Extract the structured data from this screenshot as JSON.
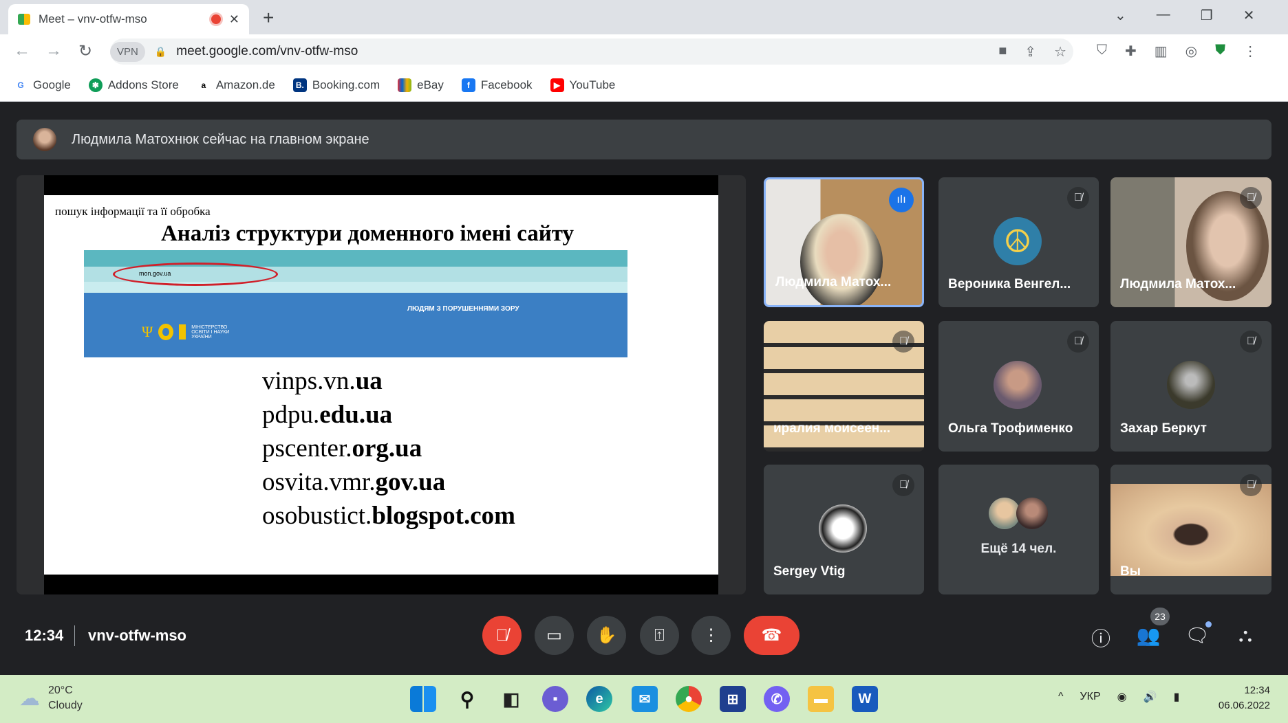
{
  "browser": {
    "tab_title": "Meet – vnv-otfw-mso",
    "url": "meet.google.com/vnv-otfw-mso",
    "vpn_label": "VPN",
    "bookmarks": [
      {
        "label": "Google",
        "color": "#4285f4",
        "glyph": "G"
      },
      {
        "label": "Addons Store",
        "color": "#0f9d58",
        "glyph": "✱"
      },
      {
        "label": "Amazon.de",
        "color": "#ffffff",
        "glyph": "a"
      },
      {
        "label": "Booking.com",
        "color": "#003580",
        "glyph": "B."
      },
      {
        "label": "eBay",
        "color": "#e53238",
        "glyph": "▣"
      },
      {
        "label": "Facebook",
        "color": "#1877f2",
        "glyph": "f"
      },
      {
        "label": "YouTube",
        "color": "#ff0000",
        "glyph": "▶"
      }
    ]
  },
  "banner": {
    "text": "Людмила Матохнюк сейчас на главном экране"
  },
  "slide": {
    "subtitle": "пошук інформації та її обробка",
    "title": "Аналіз структури доменного імені сайту",
    "embedded_site_text": "ЛЮДЯМ З ПОРУШЕННЯМИ ЗОРУ",
    "embedded_logo_text": "МІНІСТЕРСТВО ОСВІТИ І НАУКИ УКРАЇНИ",
    "embedded_url": "mon.gov.ua",
    "domains": [
      {
        "name": "vinps.vn.",
        "suffix": "ua"
      },
      {
        "name": "pdpu.",
        "suffix": "edu.ua"
      },
      {
        "name": "pscenter.",
        "suffix": "org.ua"
      },
      {
        "name": "osvita.vmr.",
        "suffix": "gov.ua"
      },
      {
        "name": "osobustict.",
        "suffix": "blogspot.com"
      }
    ]
  },
  "participants": [
    {
      "name": "Людмила Матох...",
      "speaking": true
    },
    {
      "name": "Вероника Венгел...",
      "muted": true
    },
    {
      "name": "Людмила Матох...",
      "muted": true
    },
    {
      "name": "иралия моисеен...",
      "muted": true
    },
    {
      "name": "Ольга Трофименко",
      "muted": true
    },
    {
      "name": "Захар Беркут",
      "muted": true
    },
    {
      "name": "Sergey Vtig",
      "muted": true
    },
    {
      "name": "Ещё 14 чел."
    },
    {
      "name": "Вы",
      "muted": true
    }
  ],
  "controls": {
    "time": "12:34",
    "meeting_code": "vnv-otfw-mso",
    "participant_count": "23"
  },
  "taskbar": {
    "temp": "20°C",
    "weather": "Cloudy",
    "lang": "УКР",
    "time": "12:34",
    "date": "06.06.2022"
  },
  "colors": {
    "accent": "#1a73e8",
    "danger": "#ea4335",
    "meet_bg": "#202124"
  }
}
